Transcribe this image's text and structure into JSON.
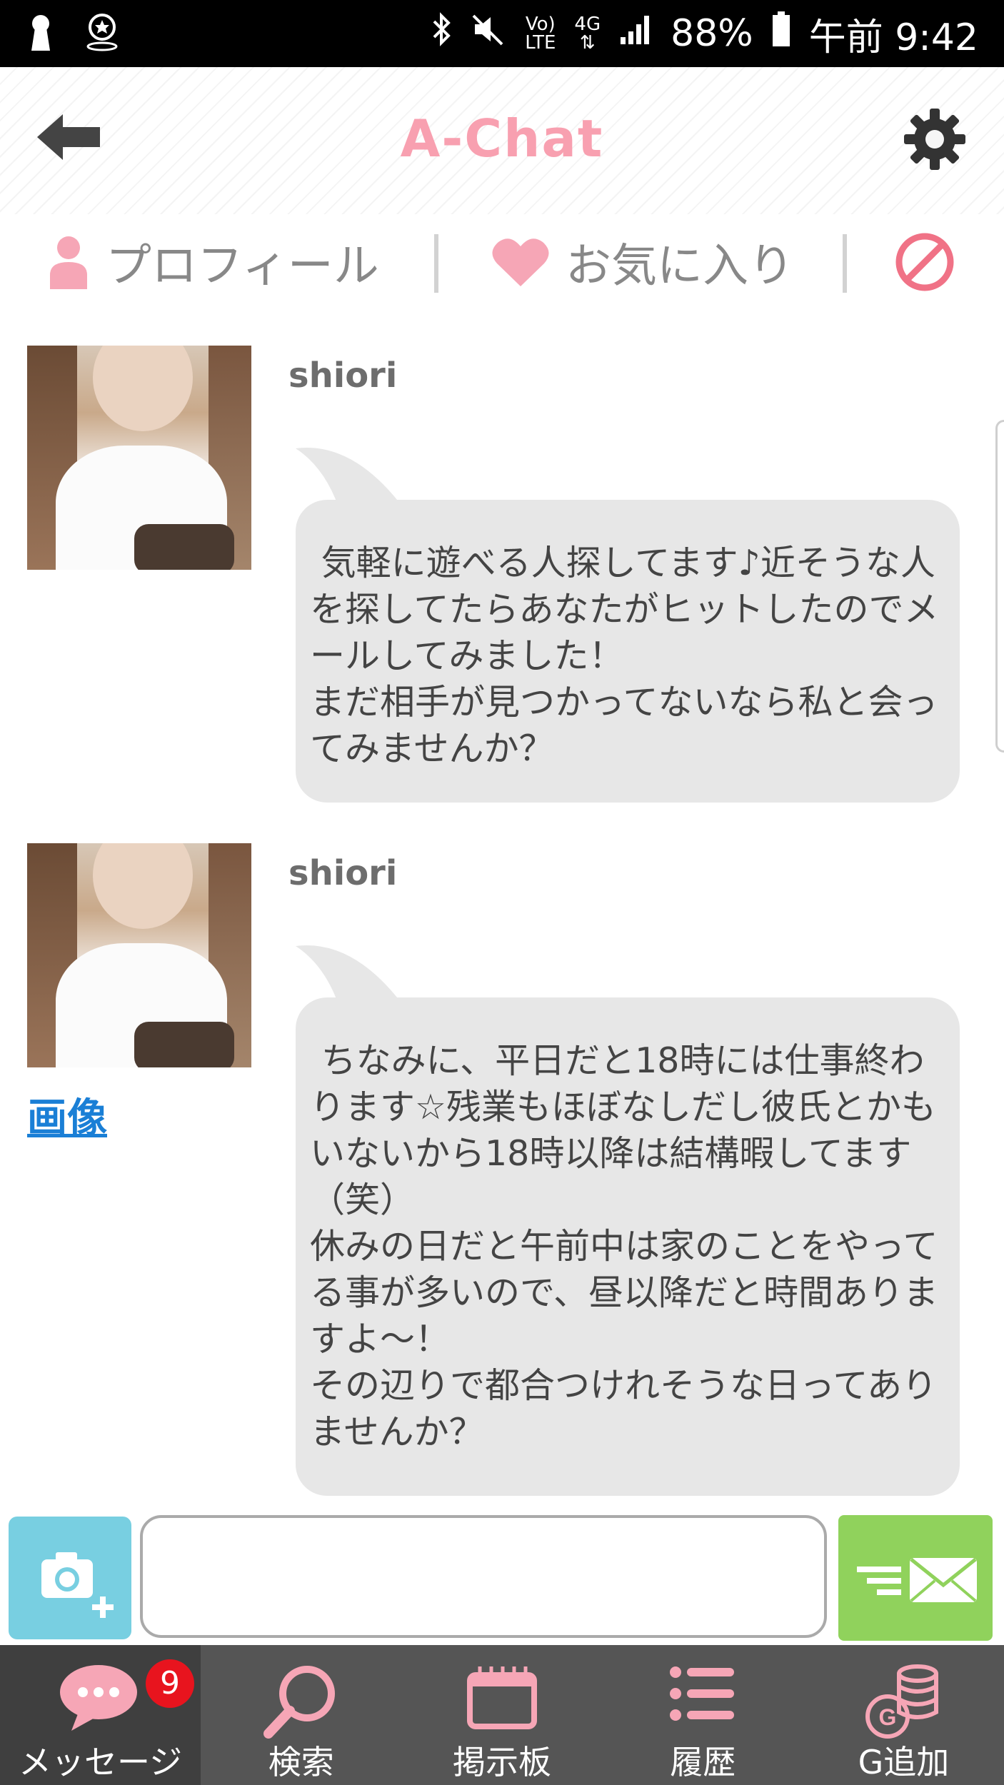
{
  "statusbar": {
    "network_top": "Vo)",
    "network_bottom": "LTE",
    "signal_label": "4G",
    "battery": "88%",
    "time": "午前 9:42"
  },
  "header": {
    "title": "A-Chat"
  },
  "tabs": {
    "profile": "プロフィール",
    "favorite": "お気に入り"
  },
  "messages": [
    {
      "sender": "shiori",
      "text": " 気軽に遊べる人探してます♪近そうな人を探してたらあなたがヒットしたのでメールしてみました！\nまだ相手が見つかってないなら私と会ってみませんか？"
    },
    {
      "sender": "shiori",
      "image_link": "画像",
      "text": " ちなみに、平日だと18時には仕事終わります☆残業もほぼなしだし彼氏とかもいないから18時以降は結構暇してます（笑）\n休みの日だと午前中は家のことをやってる事が多いので、昼以降だと時間ありますよ～！\nその辺りで都合つけれそうな日ってありませんか？"
    }
  ],
  "composer": {
    "value": ""
  },
  "bottom_nav": {
    "messages": "メッセージ",
    "messages_badge": "9",
    "search": "検索",
    "board": "掲示板",
    "history": "履歴",
    "add_points": "G追加"
  },
  "colors": {
    "title_pink": "#f8a0b0",
    "icon_pink": "#f6a6b6",
    "block_red": "#f07286",
    "bubble_gray": "#e7e7e7",
    "camera_blue": "#78cfe1",
    "send_green": "#90d25c",
    "nav_gray": "#555555",
    "badge_red": "#e8141e",
    "link_blue": "#1a7fd6"
  }
}
